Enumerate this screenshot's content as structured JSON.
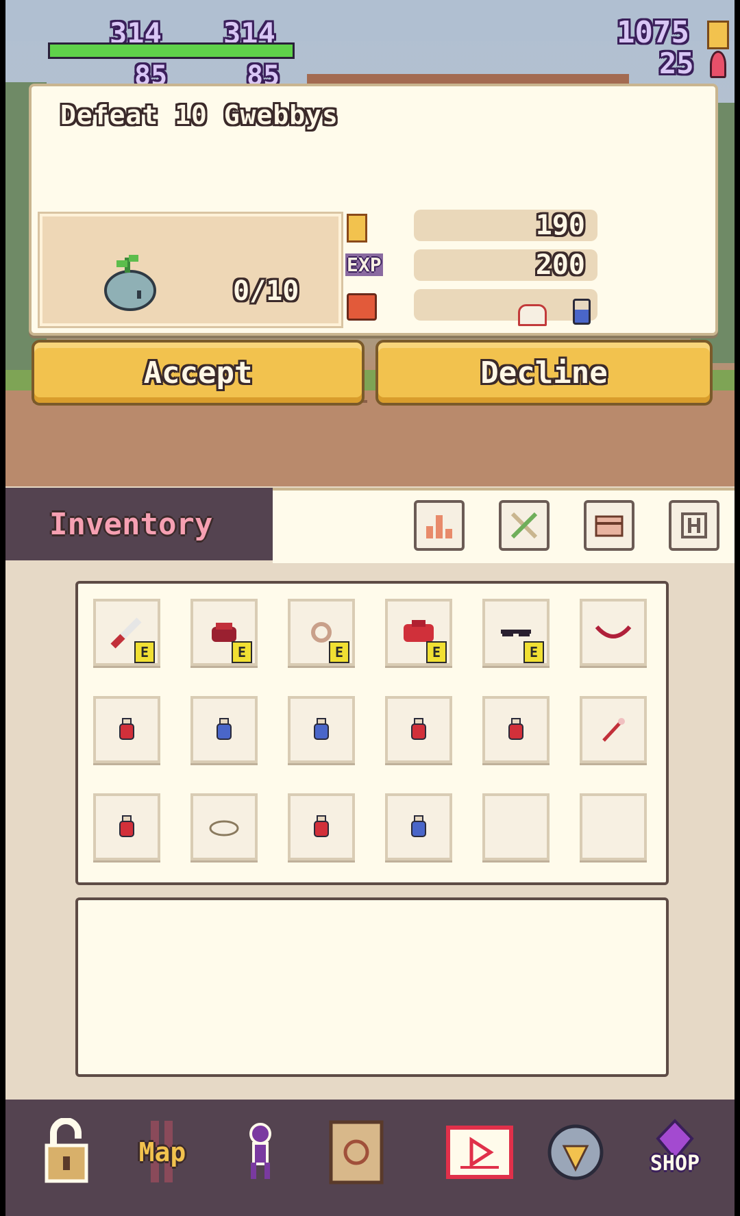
{
  "hud": {
    "hp_current": "314",
    "hp_max": "314",
    "mp_current": "85",
    "mp_max": "85",
    "hp_fill": 1.0,
    "gold": "1075",
    "gems": "25"
  },
  "quest": {
    "title": "Defeat 10 Gwebbys",
    "target_icon": "gwebby-slime-icon",
    "progress": "0/10",
    "rewards": {
      "gold_icon": "coin-icon",
      "gold": "190",
      "exp_label": "EXP",
      "exp": "200",
      "items_icon": "chest-icon",
      "items": [
        "helmet-icon",
        "potion-icon"
      ]
    },
    "accept_label": "Accept",
    "decline_label": "Decline"
  },
  "inventory": {
    "title": "Inventory",
    "tabs": [
      "stats-tab-icon",
      "equipment-tab-icon",
      "chest-tab-icon",
      "h-tab-icon"
    ],
    "equipped_badge": "E",
    "slots": [
      {
        "icon": "sword-icon",
        "equipped": true
      },
      {
        "icon": "gloves-icon",
        "equipped": true
      },
      {
        "icon": "ring-icon",
        "equipped": true
      },
      {
        "icon": "armor-icon",
        "equipped": true
      },
      {
        "icon": "sunglasses-icon",
        "equipped": true
      },
      {
        "icon": "bow-icon",
        "equipped": false
      },
      {
        "icon": "red-potion-icon",
        "equipped": false
      },
      {
        "icon": "blue-potion-icon",
        "equipped": false
      },
      {
        "icon": "blue-potion-icon",
        "equipped": false
      },
      {
        "icon": "red-potion-icon",
        "equipped": false
      },
      {
        "icon": "red-potion-icon",
        "equipped": false
      },
      {
        "icon": "wand-icon",
        "equipped": false
      },
      {
        "icon": "red-potion-icon",
        "equipped": false
      },
      {
        "icon": "bread-icon",
        "equipped": false
      },
      {
        "icon": "red-potion-icon",
        "equipped": false
      },
      {
        "icon": "blue-potion-icon",
        "equipped": false
      },
      {
        "icon": "",
        "equipped": false
      },
      {
        "icon": "",
        "equipped": false
      }
    ],
    "description": ""
  },
  "bottom_nav": {
    "items": [
      "lock-icon",
      "map-icon",
      "character-icon",
      "quest-scroll-icon",
      "video-ad-icon",
      "drill-icon",
      "shop-icon"
    ],
    "map_label": "Map",
    "shop_label": "SHOP"
  },
  "colors": {
    "hp_bar": "#5fd14a",
    "button_yellow": "#f2c24e",
    "panel_bg": "#fffbeb",
    "header_dark": "#544350",
    "inventory_title": "#f6a0b2"
  }
}
